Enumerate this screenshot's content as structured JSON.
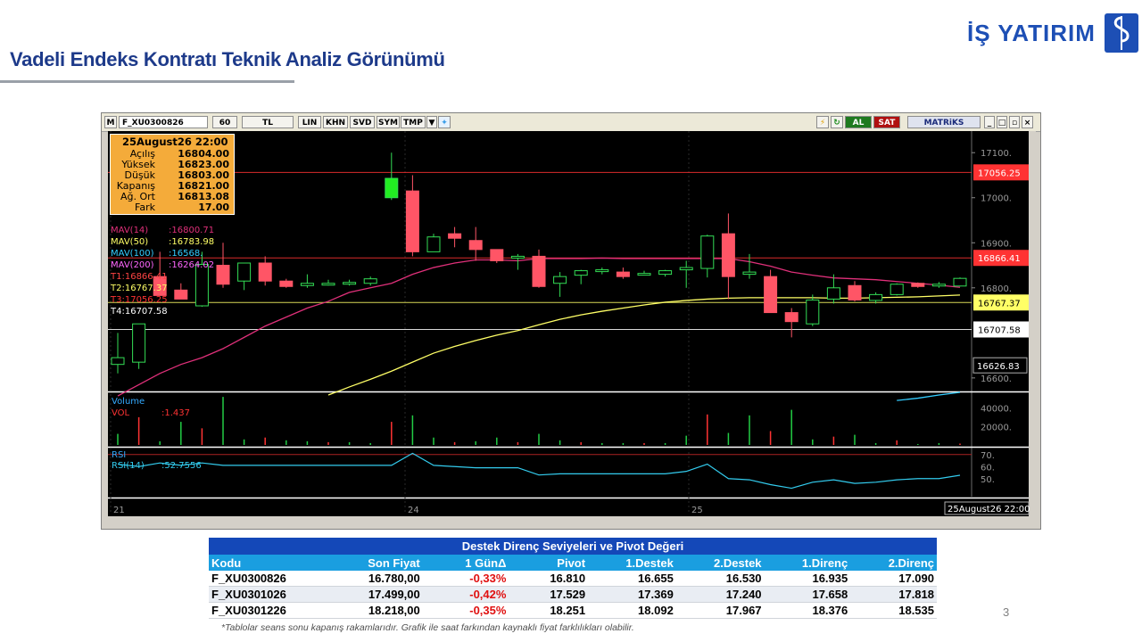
{
  "header": {
    "title": "Vadeli Endeks Kontratı Teknik Analiz Görünümü",
    "brand": "İŞ YATIRIM"
  },
  "toolbar": {
    "m": "M",
    "symbol": "F_XU0300826",
    "period": "60",
    "currency": "TL",
    "buttons": [
      "LIN",
      "KHN",
      "SVD",
      "SYM",
      "TMP"
    ],
    "al": "AL",
    "sat": "SAT",
    "matriks": "MATRiKS"
  },
  "ohlc_box": {
    "date": "25August26 22:00",
    "rows": [
      {
        "label": "Açılış",
        "value": "16804.00"
      },
      {
        "label": "Yüksek",
        "value": "16823.00"
      },
      {
        "label": "Düşük",
        "value": "16803.00"
      },
      {
        "label": "Kapanış",
        "value": "16821.00"
      },
      {
        "label": "Ağ. Ort",
        "value": "16813.08"
      },
      {
        "label": "Fark",
        "value": "17.00"
      }
    ]
  },
  "indicators": [
    {
      "label": "MAV(14)",
      "value": ":16800.71",
      "color": "#e0307a"
    },
    {
      "label": "MAV(50)",
      "value": ":16783.98",
      "color": "#ffff66"
    },
    {
      "label": "MAV(100)",
      "value": ":16568.",
      "color": "#33ccff"
    },
    {
      "label": "MAV(200)",
      "value": ":16264.02",
      "color": "#ff66ff"
    },
    {
      "label": "T1:16866.41",
      "value": "",
      "color": "#ff4444"
    },
    {
      "label": "T2:16767.37",
      "value": "",
      "color": "#ffff66"
    },
    {
      "label": "T3:17056.25",
      "value": "",
      "color": "#ff3333"
    },
    {
      "label": "T4:16707.58",
      "value": "",
      "color": "#ffffff"
    }
  ],
  "chart_data": {
    "type": "candlestick",
    "symbol": "F_XU0300826",
    "interval": "60",
    "y_range": [
      16570,
      17140
    ],
    "y_ticks": [
      "17100.",
      "17000.",
      "16900.",
      "16800.",
      "16600."
    ],
    "x_labels": [
      "21",
      "24",
      "25"
    ],
    "last_date_label": "25August26 22:00",
    "candles": [
      {
        "o": 16630,
        "h": 16700,
        "l": 16610,
        "c": 16645
      },
      {
        "o": 16635,
        "h": 16720,
        "l": 16620,
        "c": 16720
      },
      {
        "o": 16825,
        "h": 16880,
        "l": 16805,
        "c": 16783
      },
      {
        "o": 16795,
        "h": 16810,
        "l": 16775,
        "c": 16775
      },
      {
        "o": 16760,
        "h": 16880,
        "l": 16758,
        "c": 16852
      },
      {
        "o": 16850,
        "h": 16900,
        "l": 16800,
        "c": 16808
      },
      {
        "o": 16815,
        "h": 16855,
        "l": 16795,
        "c": 16855
      },
      {
        "o": 16855,
        "h": 16870,
        "l": 16805,
        "c": 16815
      },
      {
        "o": 16815,
        "h": 16820,
        "l": 16800,
        "c": 16803
      },
      {
        "o": 16805,
        "h": 16830,
        "l": 16800,
        "c": 16810
      },
      {
        "o": 16808,
        "h": 16818,
        "l": 16805,
        "c": 16810
      },
      {
        "o": 16810,
        "h": 16818,
        "l": 16805,
        "c": 16812
      },
      {
        "o": 16810,
        "h": 16825,
        "l": 16805,
        "c": 16820
      },
      {
        "o": 17000,
        "h": 17100,
        "l": 16995,
        "c": 17043
      },
      {
        "o": 17015,
        "h": 17050,
        "l": 16870,
        "c": 16880
      },
      {
        "o": 16880,
        "h": 16920,
        "l": 16880,
        "c": 16913
      },
      {
        "o": 16920,
        "h": 16935,
        "l": 16890,
        "c": 16910
      },
      {
        "o": 16905,
        "h": 16935,
        "l": 16860,
        "c": 16885
      },
      {
        "o": 16885,
        "h": 16880,
        "l": 16855,
        "c": 16860
      },
      {
        "o": 16870,
        "h": 16875,
        "l": 16840,
        "c": 16870
      },
      {
        "o": 16870,
        "h": 16885,
        "l": 16800,
        "c": 16803
      },
      {
        "o": 16810,
        "h": 16835,
        "l": 16780,
        "c": 16825
      },
      {
        "o": 16828,
        "h": 16840,
        "l": 16808,
        "c": 16838
      },
      {
        "o": 16836,
        "h": 16845,
        "l": 16830,
        "c": 16840
      },
      {
        "o": 16835,
        "h": 16845,
        "l": 16820,
        "c": 16825
      },
      {
        "o": 16830,
        "h": 16838,
        "l": 16828,
        "c": 16832
      },
      {
        "o": 16830,
        "h": 16840,
        "l": 16825,
        "c": 16838
      },
      {
        "o": 16840,
        "h": 16860,
        "l": 16800,
        "c": 16845
      },
      {
        "o": 16843,
        "h": 16918,
        "l": 16823,
        "c": 16915
      },
      {
        "o": 16920,
        "h": 16965,
        "l": 16775,
        "c": 16825
      },
      {
        "o": 16830,
        "h": 16875,
        "l": 16820,
        "c": 16835
      },
      {
        "o": 16825,
        "h": 16840,
        "l": 16745,
        "c": 16745
      },
      {
        "o": 16745,
        "h": 16755,
        "l": 16690,
        "c": 16725
      },
      {
        "o": 16720,
        "h": 16785,
        "l": 16715,
        "c": 16773
      },
      {
        "o": 16775,
        "h": 16830,
        "l": 16765,
        "c": 16800
      },
      {
        "o": 16805,
        "h": 16815,
        "l": 16770,
        "c": 16773
      },
      {
        "o": 16772,
        "h": 16790,
        "l": 16765,
        "c": 16785
      },
      {
        "o": 16785,
        "h": 16810,
        "l": 16783,
        "c": 16808
      },
      {
        "o": 16810,
        "h": 16812,
        "l": 16800,
        "c": 16803
      },
      {
        "o": 16806,
        "h": 16813,
        "l": 16800,
        "c": 16808
      },
      {
        "o": 16804,
        "h": 16823,
        "l": 16803,
        "c": 16821
      }
    ],
    "series": [
      {
        "name": "MAV(14)",
        "color": "#e0307a",
        "values": [
          16560,
          16585,
          16610,
          16630,
          16645,
          16665,
          16690,
          16715,
          16735,
          16755,
          16770,
          16790,
          16800,
          16810,
          16830,
          16845,
          16855,
          16862,
          16862,
          16860,
          16865,
          16865,
          16865,
          16866,
          16865,
          16865,
          16865,
          16865,
          16865,
          16865,
          16858,
          16848,
          16835,
          16828,
          16822,
          16820,
          16818,
          16814,
          16810,
          16806,
          16801
        ]
      },
      {
        "name": "MAV(50)",
        "color": "#ffff66",
        "values": [
          null,
          null,
          null,
          null,
          null,
          null,
          null,
          null,
          null,
          null,
          16562,
          16580,
          16597,
          16615,
          16635,
          16655,
          16670,
          16683,
          16695,
          16705,
          16718,
          16730,
          16740,
          16748,
          16755,
          16762,
          16768,
          16772,
          16775,
          16777,
          16778,
          16778,
          16778,
          16778,
          16777,
          16777,
          16778,
          16779,
          16780,
          16782,
          16784
        ]
      },
      {
        "name": "MAV(100)",
        "color": "#33ccff",
        "values": [
          null,
          null,
          null,
          null,
          null,
          null,
          null,
          null,
          null,
          null,
          null,
          null,
          null,
          null,
          null,
          null,
          null,
          null,
          null,
          null,
          null,
          null,
          null,
          null,
          null,
          null,
          null,
          null,
          null,
          null,
          null,
          null,
          null,
          null,
          null,
          null,
          null,
          16550,
          16555,
          16562,
          16568
        ]
      }
    ],
    "levels": [
      {
        "name": "T1",
        "value": 16866.41,
        "label": "16866.41",
        "color": "#ff3333"
      },
      {
        "name": "T2",
        "value": 16767.37,
        "label": "16767.37",
        "color": "#ffff66"
      },
      {
        "name": "T3",
        "value": 17056.25,
        "label": "17056.25",
        "color": "#ff3333"
      },
      {
        "name": "T4",
        "value": 16707.58,
        "label": "16707.58",
        "color": "#ffffff"
      }
    ],
    "crosshair_label": "16626.83",
    "volume": {
      "title": "Volume",
      "label": "VOL",
      "value": ":1.437",
      "ticks": [
        "40000.",
        "20000."
      ],
      "max": 55000,
      "values": [
        12000,
        30000,
        4000,
        25000,
        18000,
        52000,
        6000,
        8000,
        5000,
        4000,
        3000,
        3000,
        2000,
        25000,
        32000,
        8000,
        3000,
        4000,
        8000,
        3000,
        12000,
        5000,
        3000,
        2000,
        2000,
        2000,
        2000,
        10000,
        33000,
        13000,
        32000,
        15000,
        38000,
        6000,
        9000,
        11000,
        2000,
        5000,
        1000,
        2000,
        1437
      ]
    },
    "rsi": {
      "title": "RSI",
      "label": "RSI(14)",
      "value": ":52.7556",
      "ticks": [
        "70.",
        "60.",
        "50."
      ],
      "range": [
        35,
        75
      ],
      "values": [
        62,
        60,
        63,
        61,
        63,
        61,
        61,
        61,
        61,
        61,
        61,
        61,
        61,
        61,
        71,
        61,
        60,
        59,
        59,
        59,
        53,
        54,
        54,
        54,
        54,
        54,
        54,
        56,
        62,
        50,
        49,
        45,
        42,
        47,
        49,
        46,
        47,
        49,
        50,
        50,
        52.76
      ]
    }
  },
  "pivot_table": {
    "title": "Destek Direnç Seviyeleri ve Pivot Değeri",
    "columns": [
      "Kodu",
      "Son Fiyat",
      "1 GünΔ",
      "Pivot",
      "1.Destek",
      "2.Destek",
      "1.Direnç",
      "2.Direnç"
    ],
    "rows": [
      [
        "F_XU0300826",
        "16.780,00",
        "-0,33%",
        "16.810",
        "16.655",
        "16.530",
        "16.935",
        "17.090"
      ],
      [
        "F_XU0301026",
        "17.499,00",
        "-0,42%",
        "17.529",
        "17.369",
        "17.240",
        "17.658",
        "17.818"
      ],
      [
        "F_XU0301226",
        "18.218,00",
        "-0,35%",
        "18.251",
        "18.092",
        "17.967",
        "18.376",
        "18.535"
      ]
    ]
  },
  "page_number": "3",
  "footnote": "*Tablolar seans sonu kapanış rakamlarıdır. Grafik ile saat farkından kaynaklı fiyat farklılıkları olabilir."
}
